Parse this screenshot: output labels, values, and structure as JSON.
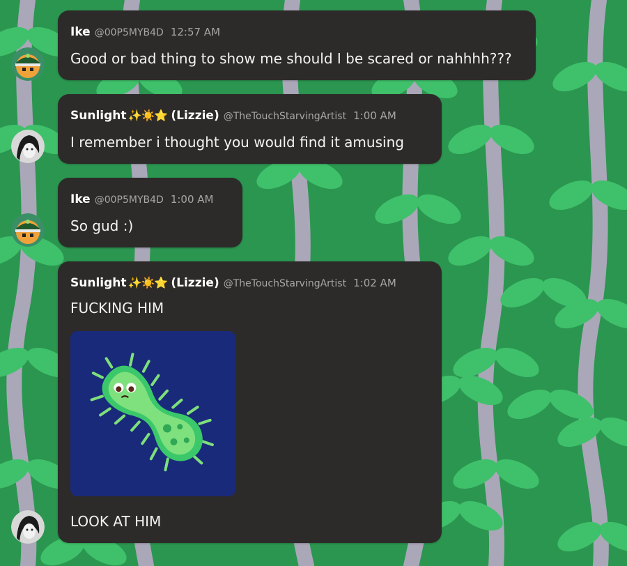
{
  "messages": [
    {
      "author": "Ike",
      "handle": "@00P5MYB4D",
      "time": "12:57 AM",
      "text": "Good or bad thing to show me should I be scared or nahhhh???"
    },
    {
      "author": "Sunlight",
      "author_suffix": "(Lizzie)",
      "emoji": "✨☀️⭐",
      "handle": "@TheTouchStarvingArtist",
      "time": "1:00 AM",
      "text": "I remember i thought you would find it amusing"
    },
    {
      "author": "Ike",
      "handle": "@00P5MYB4D",
      "time": "1:00 AM",
      "text": "So gud :)"
    },
    {
      "author": "Sunlight",
      "author_suffix": "(Lizzie)",
      "emoji": "✨☀️⭐",
      "handle": "@TheTouchStarvingArtist",
      "time": "1:02 AM",
      "text": "FUCKING HIM",
      "attachment_icon": "microbe-icon",
      "text2": "LOOK AT HIM"
    }
  ],
  "colors": {
    "bubble": "#2d2b2a",
    "background_dark": "#2e9a55",
    "leaf": "#3fc06a",
    "vine": "#b8a9c4",
    "attachment_bg": "#1a2a7a"
  }
}
